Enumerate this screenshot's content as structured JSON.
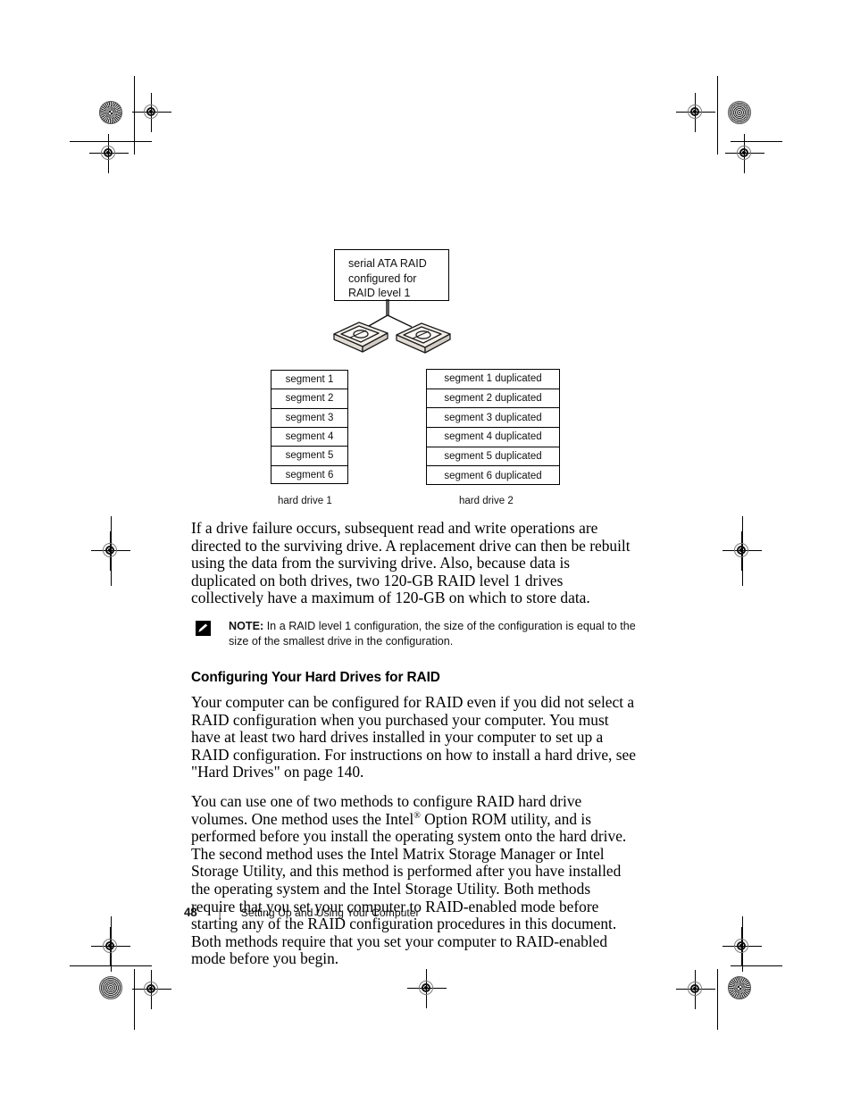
{
  "document": {
    "page_number": "48",
    "footer_separator": "|",
    "footer_title": "Setting Up and Using Your Computer"
  },
  "figure": {
    "callout": {
      "line1": "serial ATA RAID",
      "line2": "configured for",
      "line3": "RAID level 1"
    },
    "drive1": {
      "caption": "hard drive 1",
      "segments": [
        "segment 1",
        "segment 2",
        "segment 3",
        "segment 4",
        "segment 5",
        "segment 6"
      ]
    },
    "drive2": {
      "caption": "hard drive 2",
      "segments": [
        "segment 1 duplicated",
        "segment 2 duplicated",
        "segment 3 duplicated",
        "segment 4 duplicated",
        "segment 5 duplicated",
        "segment 6 duplicated"
      ]
    }
  },
  "body": {
    "paragraph1": "If a drive failure occurs, subsequent read and write operations are directed to the surviving drive. A replacement drive can then be rebuilt using the data from the surviving drive. Also, because data is duplicated on both drives, two 120-GB RAID level 1 drives collectively have a maximum of 120-GB on which to store data.",
    "note_label": "NOTE:",
    "note_text": "In a RAID level 1 configuration, the size of the configuration is equal to the size of the smallest drive in the configuration.",
    "heading": "Configuring Your Hard Drives for RAID",
    "paragraph2": "Your computer can be configured for RAID even if you did not select a RAID configuration when you purchased your computer. You must have at least two hard drives installed in your computer to set up a RAID configuration. For instructions on how to install a hard drive, see \"Hard Drives\" on page 140.",
    "paragraph3_part1": "You can use one of two methods to configure RAID hard drive volumes. One method uses the Intel",
    "paragraph3_sup": "®",
    "paragraph3_part2": " Option ROM utility, and is performed before you install the operating system onto the hard drive. The second method uses the Intel Matrix Storage Manager or Intel Storage Utility, and this method is performed after you have installed the operating system and the Intel Storage Utility. Both methods require that you set your computer to RAID-enabled mode before starting any of the RAID configuration procedures in this document. Both methods require that you set your computer to RAID-enabled mode before you begin."
  },
  "colors": {
    "text": "#000000",
    "rule": "#000000",
    "page_background": "#ffffff"
  }
}
